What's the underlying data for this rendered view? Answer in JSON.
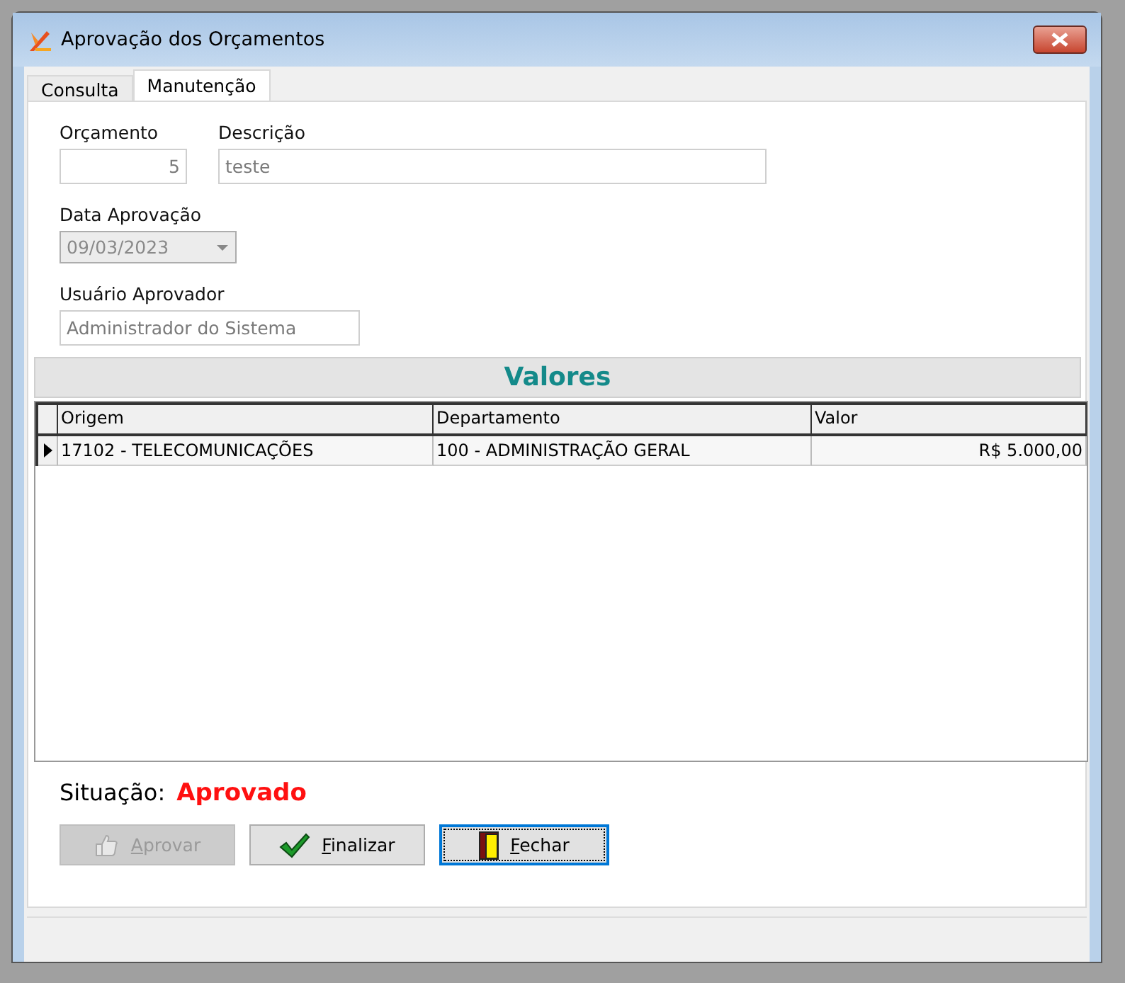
{
  "window": {
    "title": "Aprovação dos Orçamentos"
  },
  "tabs": [
    {
      "label": "Consulta",
      "selected": false
    },
    {
      "label": "Manutenção",
      "selected": true
    }
  ],
  "form": {
    "orcamento": {
      "label": "Orçamento",
      "value": "5"
    },
    "descricao": {
      "label": "Descrição",
      "value": "teste"
    },
    "data_aprovacao": {
      "label": "Data Aprovação",
      "value": "09/03/2023",
      "disabled": true
    },
    "usuario_aprovador": {
      "label": "Usuário Aprovador",
      "value": "Administrador do Sistema"
    }
  },
  "valores": {
    "title": "Valores",
    "columns": [
      "Origem",
      "Departamento",
      "Valor"
    ],
    "rows": [
      {
        "cells": [
          "17102 - TELECOMUNICAÇÕES",
          "100 - ADMINISTRAÇÃO GERAL",
          "R$ 5.000,00"
        ],
        "selected": true
      }
    ]
  },
  "situacao": {
    "label": "Situação:",
    "value": "Aprovado"
  },
  "buttons": [
    {
      "label": "Aprovar",
      "kind": "approve",
      "disabled": true,
      "focused": false
    },
    {
      "label": "Finalizar",
      "kind": "finish",
      "disabled": false,
      "focused": false
    },
    {
      "label": "Fechar",
      "kind": "close",
      "disabled": false,
      "focused": true
    }
  ]
}
